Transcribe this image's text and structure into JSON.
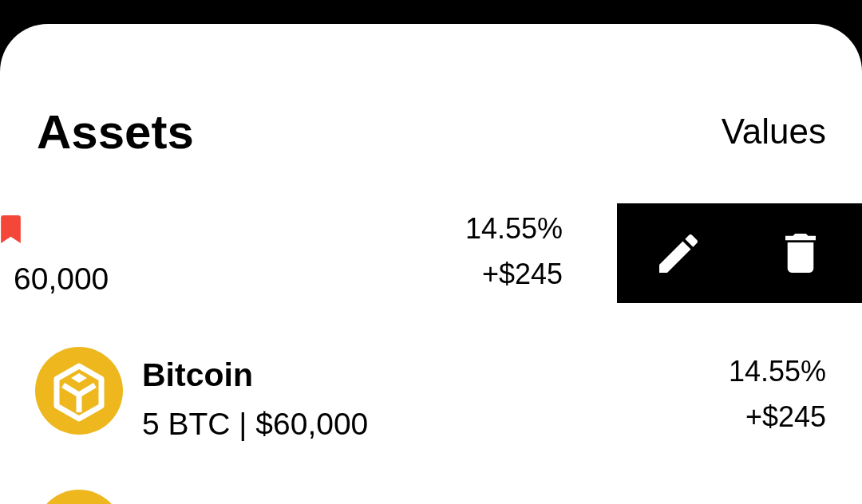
{
  "header": {
    "title": "Assets",
    "values_label": "Values"
  },
  "assets": [
    {
      "kind": "swiped",
      "bookmarked": true,
      "holdings": "60,000",
      "change_percent": "14.55%",
      "change_amount": "+$245",
      "actions": [
        {
          "kind": "edit"
        },
        {
          "kind": "delete"
        }
      ]
    },
    {
      "kind": "normal",
      "name": "Bitcoin",
      "bookmarked": false,
      "holdings": "5 BTC | $60,000",
      "change_percent": "14.55%",
      "change_amount": "+$245"
    },
    {
      "kind": "partial"
    }
  ]
}
